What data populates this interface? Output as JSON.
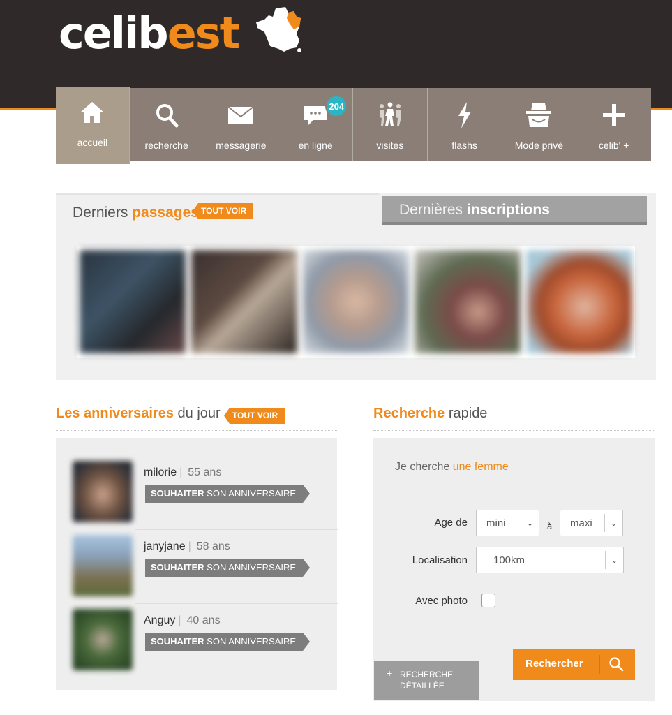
{
  "logo": {
    "part1": "celib",
    "part2": "est"
  },
  "colors": {
    "accent": "#ef8a1b",
    "header_bg": "#30292a",
    "nav_bg": "#8a7e77",
    "nav_active_bg": "#aa9d8b",
    "badge": "#2ab5c5"
  },
  "nav": {
    "items": [
      {
        "label": "accueil",
        "icon": "home-icon"
      },
      {
        "label": "recherche",
        "icon": "search-icon"
      },
      {
        "label": "messagerie",
        "icon": "envelope-icon"
      },
      {
        "label": "en ligne",
        "icon": "chat-icon",
        "badge": "204"
      },
      {
        "label": "visites",
        "icon": "walking-people-icon"
      },
      {
        "label": "flashs",
        "icon": "lightning-icon"
      },
      {
        "label": "Mode privé",
        "icon": "incognito-icon"
      },
      {
        "label": "celib' +",
        "icon": "plus-icon"
      }
    ]
  },
  "tabs": {
    "passages": {
      "prefix": "Derniers ",
      "highlight": "passages",
      "see_all": "TOUT VOIR"
    },
    "inscriptions": {
      "prefix": "Dernières ",
      "highlight": "inscriptions"
    }
  },
  "anniversaires": {
    "title_highlight": "Les anniversaires",
    "title_rest": " du jour",
    "see_all": "TOUT VOIR",
    "wish_bold": "SOUHAITER",
    "wish_rest": " SON ANNIVERSAIRE",
    "people": [
      {
        "name": "milorie",
        "age": "55 ans"
      },
      {
        "name": "janyjane",
        "age": "58 ans"
      },
      {
        "name": "Anguy",
        "age": "40 ans"
      }
    ]
  },
  "recherche": {
    "title_highlight": "Recherche",
    "title_rest": " rapide",
    "seek_prefix": "Je cherche ",
    "seek_value": "une femme",
    "age_label": "Age de",
    "age_min": "mini",
    "age_sep": "à",
    "age_max": "maxi",
    "loc_label": "Localisation",
    "loc_value": "100km",
    "photo_label": "Avec photo",
    "detail_line1": "RECHERCHE",
    "detail_line2": "DÉTAILLÉE",
    "submit": "Rechercher"
  }
}
